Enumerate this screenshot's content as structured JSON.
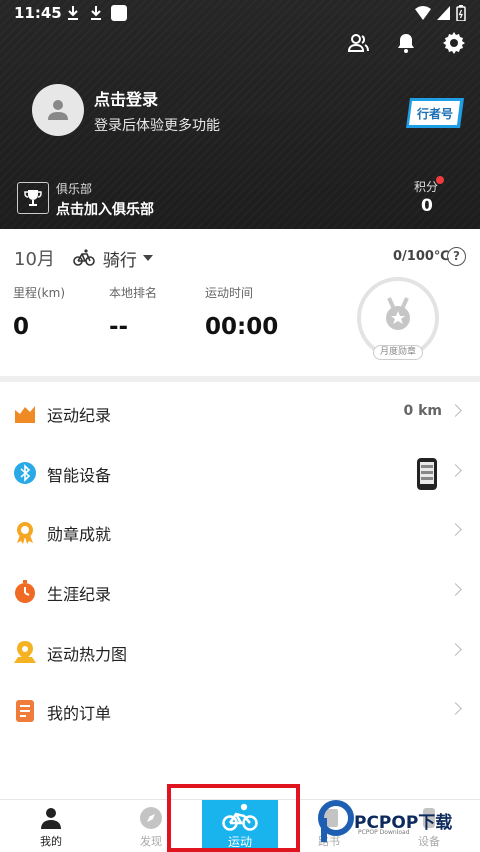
{
  "status_bar": {
    "time": "11:45"
  },
  "profile": {
    "login_title": "点击登录",
    "login_subtitle": "登录后体验更多功能",
    "badge": "行者号"
  },
  "club": {
    "label": "俱乐部",
    "join": "点击加入俱乐部"
  },
  "points": {
    "label": "积分",
    "value": "0"
  },
  "stats": {
    "month": "10月",
    "sport": "骑行",
    "goal": "0/100℃",
    "help": "?",
    "items": [
      {
        "label": "里程(km)",
        "value": "0"
      },
      {
        "label": "本地排名",
        "value": "--"
      },
      {
        "label": "运动时间",
        "value": "00:00"
      }
    ],
    "medal_label": "月度勋章"
  },
  "menu": [
    {
      "label": "运动纪录",
      "value": "0 km",
      "icon": "chart-icon"
    },
    {
      "label": "智能设备",
      "value": "",
      "icon": "bluetooth-icon"
    },
    {
      "label": "勋章成就",
      "value": "",
      "icon": "medal-icon"
    },
    {
      "label": "生涯纪录",
      "value": "",
      "icon": "stopwatch-icon"
    },
    {
      "label": "运动热力图",
      "value": "",
      "icon": "map-pin-icon"
    },
    {
      "label": "我的订单",
      "value": "",
      "icon": "document-icon"
    }
  ],
  "nav": {
    "tabs": [
      {
        "label": "我的"
      },
      {
        "label": "发现"
      },
      {
        "label": "运动"
      },
      {
        "label": "路书"
      },
      {
        "label": "设备"
      }
    ]
  },
  "watermark": {
    "text": "PCPOP下载",
    "sub": "PCPOP Download"
  },
  "colors": {
    "accent": "#19b3ee",
    "header_bg": "#222222",
    "highlight": "#e0141e",
    "orange": "#f08a24"
  }
}
